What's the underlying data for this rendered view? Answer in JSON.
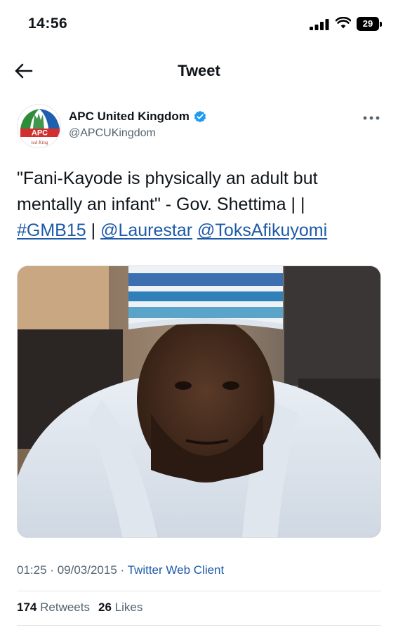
{
  "status_bar": {
    "time": "14:56",
    "battery": "29",
    "icons": [
      "signal-icon",
      "wifi-icon",
      "battery-icon"
    ]
  },
  "header": {
    "title": "Tweet",
    "back_icon": "arrow-left-icon"
  },
  "author": {
    "name": "APC United Kingdom",
    "handle": "@APCUKingdom",
    "verified": true,
    "avatar_text": "APC",
    "avatar_subtext": "ted King",
    "more_icon": "more-horizontal-icon"
  },
  "tweet": {
    "text_line1": "\"Fani-Kayode is physically an adult but",
    "text_line2": "mentally an infant\" - Gov. Shettima |  |",
    "hashtag": "#GMB15",
    "separator": "|",
    "mention1": "@Laurestar",
    "mention2": "@ToksAfikuyomi"
  },
  "meta": {
    "time": "01:25",
    "date": "09/03/2015",
    "dot": "·",
    "client": "Twitter Web Client"
  },
  "stats": {
    "retweets_count": "174",
    "retweets_label": "Retweets",
    "likes_count": "26",
    "likes_label": "Likes"
  },
  "colors": {
    "link": "#1d5aa8",
    "verified": "#1d9bf0",
    "secondary_text": "#536471"
  }
}
